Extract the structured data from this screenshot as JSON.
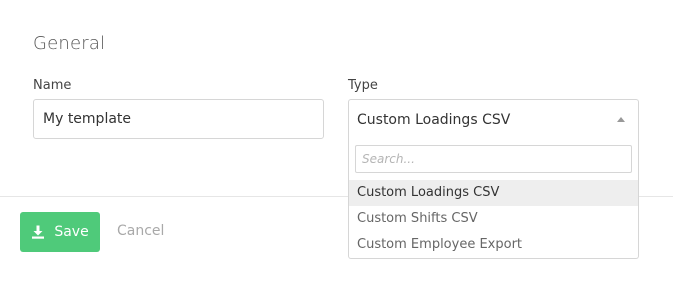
{
  "section": {
    "title": "General"
  },
  "name_field": {
    "label": "Name",
    "value": "My template"
  },
  "type_field": {
    "label": "Type",
    "selected": "Custom Loadings CSV",
    "dropdown": {
      "search_placeholder": "Search...",
      "options": [
        {
          "label": "Custom Loadings CSV",
          "highlighted": true
        },
        {
          "label": "Custom Shifts CSV",
          "highlighted": false
        },
        {
          "label": "Custom Employee Export",
          "highlighted": false
        }
      ]
    }
  },
  "actions": {
    "save_label": "Save",
    "cancel_label": "Cancel"
  },
  "colors": {
    "save_button": "#4fca7a",
    "highlight": "#eeeeee"
  },
  "icons": {
    "save": "download-icon",
    "select_caret": "caret-up-icon"
  }
}
